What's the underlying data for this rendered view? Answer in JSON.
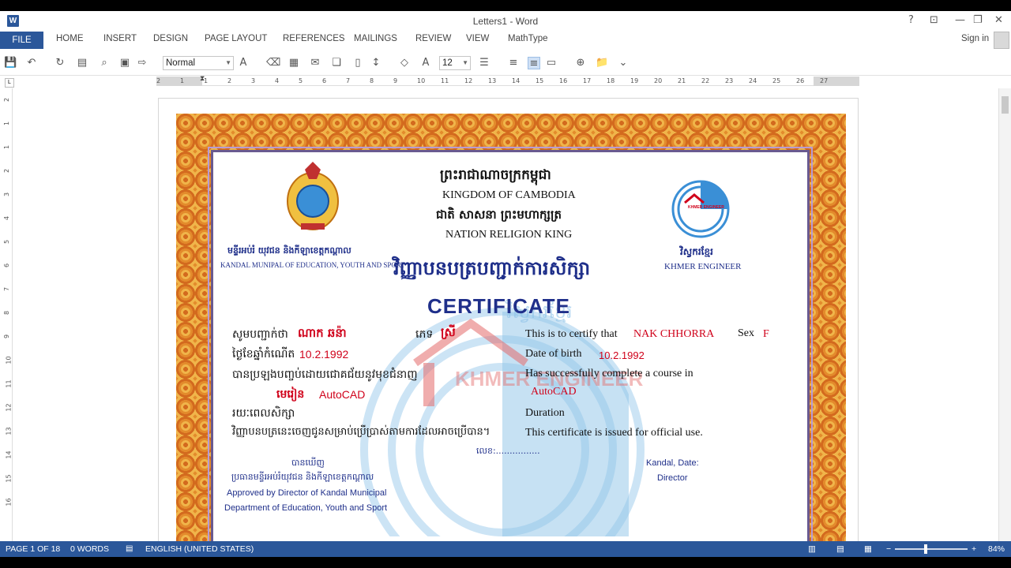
{
  "window": {
    "title": "Letters1 - Word",
    "help": "?",
    "ribbon_display": "⊡",
    "restore": "❐",
    "close": "✕"
  },
  "tabs": {
    "file": "FILE",
    "items": [
      "HOME",
      "INSERT",
      "DESIGN",
      "PAGE LAYOUT",
      "REFERENCES",
      "MAILINGS",
      "REVIEW",
      "VIEW",
      "MathType"
    ],
    "signin": "Sign in"
  },
  "toolbar": {
    "style_value": "Normal",
    "font_size_value": "12"
  },
  "ruler": {
    "labels": [
      "2",
      "1",
      "1",
      "2",
      "3",
      "4",
      "5",
      "6",
      "7",
      "8",
      "9",
      "10",
      "11",
      "12",
      "13",
      "14",
      "15",
      "16",
      "17",
      "18",
      "19",
      "20",
      "21",
      "22",
      "23",
      "24",
      "25",
      "26",
      "27"
    ],
    "vlabels": [
      "2",
      "1",
      "1",
      "2",
      "3",
      "4",
      "5",
      "6",
      "7",
      "8",
      "9",
      "10",
      "11",
      "12",
      "13",
      "14",
      "15",
      "16"
    ]
  },
  "certificate": {
    "kingdom_kh": "ព្រះរាជាណាចក្រកម្ពុជា",
    "kingdom_en": "KINGDOM OF CAMBODIA",
    "motto_kh": "ជាតិ សាសនា ព្រះមហាក្សត្រ",
    "motto_en": "NATION RELIGION KING",
    "left_org_kh": "មន្ទីរអប់រំ យុវជន និងកីឡាខេត្តកណ្ដាល",
    "left_org_en": "KANDAL MUNIPAL OF EDUCATION, YOUTH AND SPORT",
    "right_org_kh": "វិស្វករខ្មែរ",
    "right_org_en": "KHMER ENGINEER",
    "logo_text": "KHMER ENGINEER",
    "title_kh": "វិញ្ញាបនបត្របញ្ជាក់ការសិក្សា",
    "title_en": "CERTIFICATE",
    "watermark_kh": "វិស្វករខ្មែរ",
    "watermark_en": "KHMER ENGINEER",
    "kh_lines": {
      "certify_label": "សូមបញ្ជាក់ថា",
      "name_kh": "ណាក ឆន៉ា",
      "sex_label": "ភេទ",
      "sex_kh": "ស្រី",
      "dob_label": "ថ្ងៃខែឆ្នាំកំណើត",
      "dob_value": "10.2.1992",
      "passed_label": "បានប្រឡងបញ្ចប់ដោយជោគជ័យនូវមុខជំនាញ",
      "course_label": "មេរៀន",
      "course_value": "AutoCAD",
      "duration_label": "រយៈពេលសិក្សា",
      "issued_label": "វិញ្ញាបនបត្រនេះចេញជូនសម្រាប់ប្រើប្រាស់តាមការដែលអាចប្រើបាន។",
      "number_label": "លេខ:................"
    },
    "en_lines": {
      "certify_label": "This is to certify that",
      "name": "NAK CHHORRA",
      "sex_label": "Sex",
      "sex_value": "F",
      "dob_label": "Date of birth",
      "dob_value": "10.2.1992",
      "course_label": "Has successfully complete a course in",
      "course_value": "AutoCAD",
      "duration_label": "Duration",
      "issued_label": "This certificate is issued for official use."
    },
    "left_sign": {
      "seen_kh": "បានឃើញ",
      "director_kh": "ប្រធានមន្ទីរអប់រំយុវជន និងកីឡាខេត្តកណ្ដាល",
      "approved_en": "Approved by Director of Kandal Municipal",
      "dept_en": "Department of Education, Youth and Sport"
    },
    "right_sign": {
      "place_date": "Kandal, Date:",
      "director": "Director"
    }
  },
  "status": {
    "page": "PAGE 1 OF 18",
    "words": "0 WORDS",
    "language": "ENGLISH (UNITED STATES)",
    "zoom": "84%"
  },
  "colors": {
    "accent": "#2b579a",
    "red": "#d0021b",
    "navy": "#1f2f8a",
    "orange": "#e38b2c"
  }
}
